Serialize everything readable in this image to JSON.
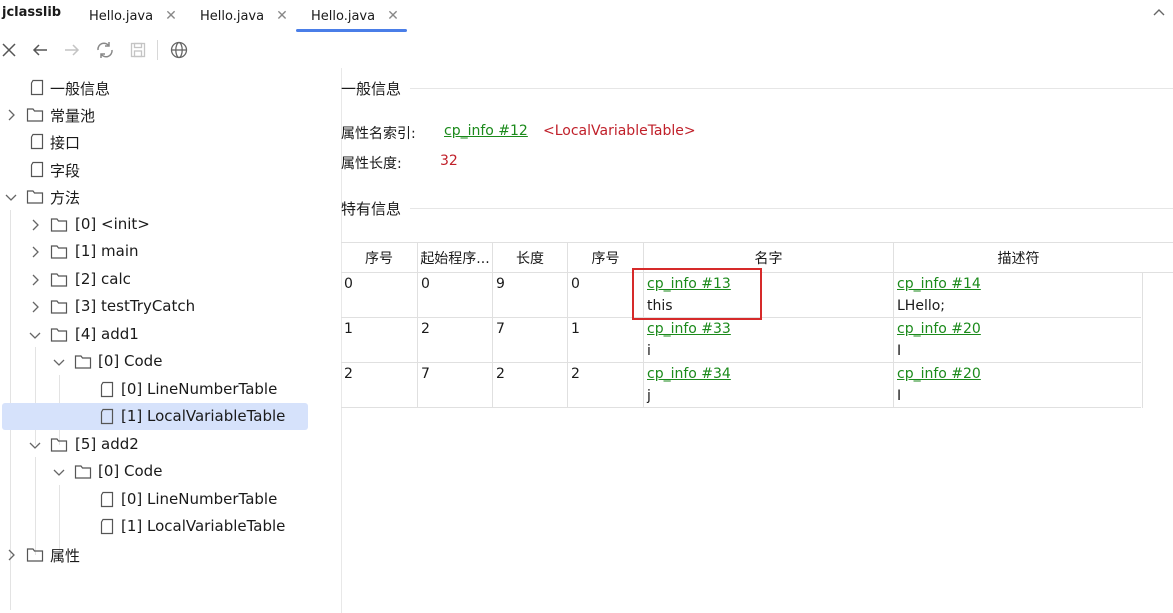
{
  "app": {
    "title": "jclasslib"
  },
  "tabs": [
    {
      "label": "Hello.java",
      "close": "✕"
    },
    {
      "label": "Hello.java",
      "close": "✕"
    },
    {
      "label": "Hello.java",
      "close": "✕",
      "active": true
    }
  ],
  "toolbar": {
    "icons": [
      "close-icon",
      "back-icon",
      "forward-icon",
      "reload-icon",
      "save-icon",
      "web-icon"
    ]
  },
  "tree": {
    "general": "一般信息",
    "constant_pool": "常量池",
    "interfaces": "接口",
    "fields": "字段",
    "methods": "方法",
    "method_init": "[0] <init>",
    "method_main": "[1] main",
    "method_calc": "[2] calc",
    "method_try": "[3] testTryCatch",
    "method_add1": "[4] add1",
    "add1_code": "[0] Code",
    "add1_lnt": "[0] LineNumberTable",
    "add1_lvt": "[1] LocalVariableTable",
    "method_add2": "[5] add2",
    "add2_code": "[0] Code",
    "add2_lnt": "[0] LineNumberTable",
    "add2_lvt": "[1] LocalVariableTable",
    "attributes": "属性"
  },
  "general_info": {
    "title": "一般信息",
    "name_index_label": "属性名索引:",
    "name_index_link": "cp_info #12",
    "name_index_value": "<LocalVariableTable>",
    "length_label": "属性长度:",
    "length_value": "32"
  },
  "specific_info": {
    "title": "特有信息",
    "columns": [
      "序号",
      "起始程序...",
      "长度",
      "序号",
      "名字",
      "描述符"
    ],
    "rows": [
      {
        "index": "0",
        "start_pc": "0",
        "length": "9",
        "slot": "0",
        "name_link": "cp_info #13",
        "name_value": "this",
        "desc_link": "cp_info #14",
        "desc_value": "LHello;"
      },
      {
        "index": "1",
        "start_pc": "2",
        "length": "7",
        "slot": "1",
        "name_link": "cp_info #33",
        "name_value": "i",
        "desc_link": "cp_info #20",
        "desc_value": "I"
      },
      {
        "index": "2",
        "start_pc": "7",
        "length": "2",
        "slot": "2",
        "name_link": "cp_info #34",
        "name_value": "j",
        "desc_link": "cp_info #20",
        "desc_value": "I"
      }
    ]
  },
  "colors": {
    "link": "#1b8a1b",
    "value_red": "#c0202a",
    "accent": "#4a7ee8",
    "selection": "#d6e2fb",
    "highlight": "#d62a2a"
  }
}
